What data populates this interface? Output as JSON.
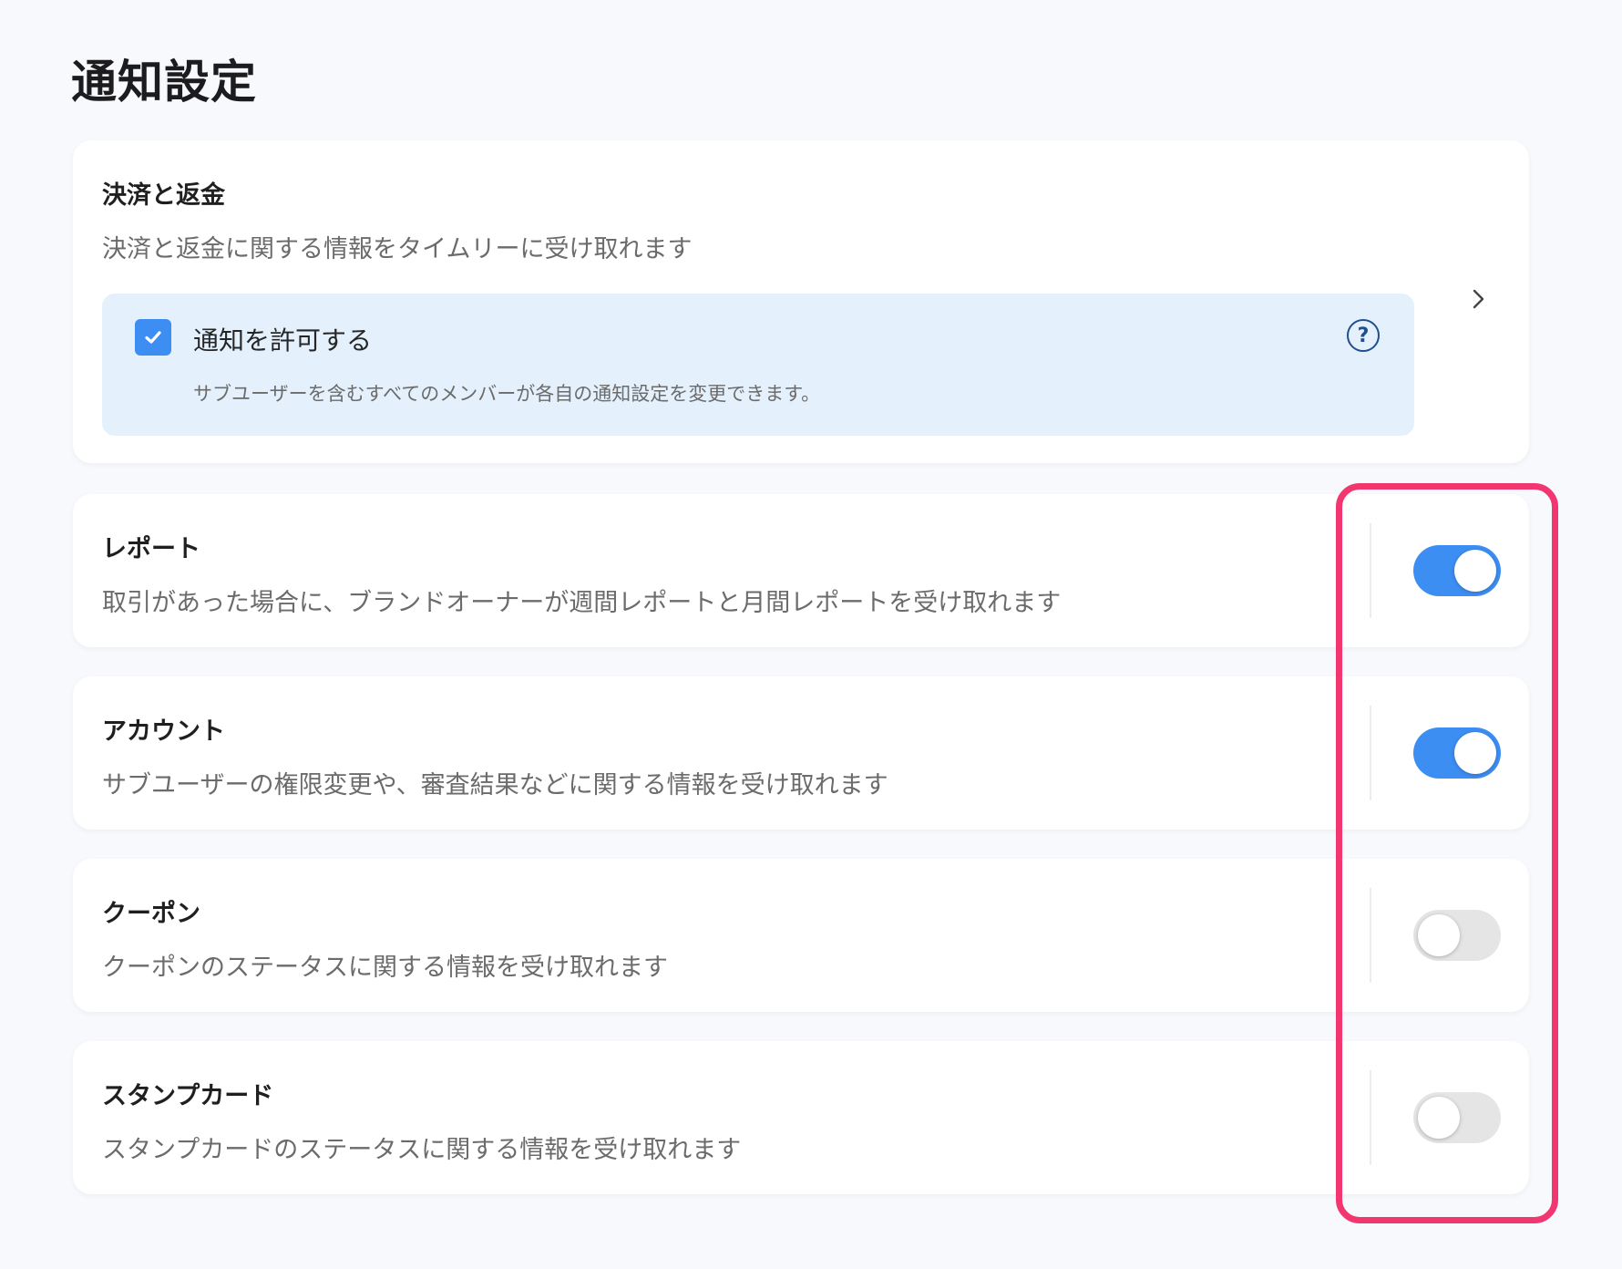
{
  "page": {
    "title": "通知設定"
  },
  "payment": {
    "title": "決済と返金",
    "description": "決済と返金に関する情報をタイムリーに受け取れます",
    "permission": {
      "checked": true,
      "label": "通知を許可する",
      "note": "サブユーザーを含むすべてのメンバーが各自の通知設定を変更できます。"
    }
  },
  "settings": [
    {
      "title": "レポート",
      "description": "取引があった場合に、ブランドオーナーが週間レポートと月間レポートを受け取れます",
      "enabled": true
    },
    {
      "title": "アカウント",
      "description": "サブユーザーの権限変更や、審査結果などに関する情報を受け取れます",
      "enabled": true
    },
    {
      "title": "クーポン",
      "description": "クーポンのステータスに関する情報を受け取れます",
      "enabled": false
    },
    {
      "title": "スタンプカード",
      "description": "スタンプカードのステータスに関する情報を受け取れます",
      "enabled": false
    }
  ],
  "colors": {
    "accent": "#3d8ef3",
    "highlight": "#f13670",
    "permission_bg": "#e4f1fd"
  },
  "icons": {
    "checkbox": "check-icon",
    "help": "question-circle-icon",
    "expand": "chevron-right-icon"
  }
}
